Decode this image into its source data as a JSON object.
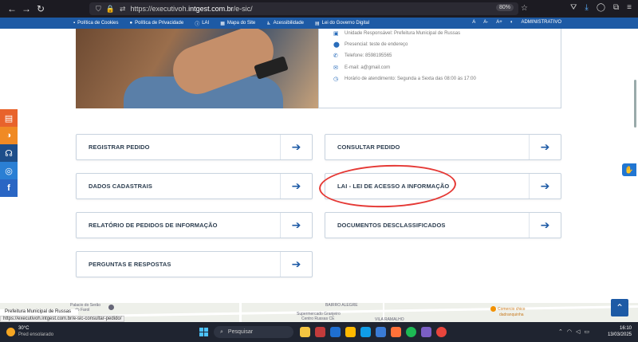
{
  "browser": {
    "url_prefix": "https://executivoh.",
    "url_domain": "intgest.com.br",
    "url_path": "/e-sic/",
    "zoom": "80%"
  },
  "govbar": {
    "items": [
      "Política de Cookies",
      "Política de Privacidade",
      "LAI",
      "Mapa do Site",
      "Acessibilidade",
      "Lei do Governo Digital"
    ],
    "font_controls": [
      "A",
      "A-",
      "A+"
    ],
    "admin": "ADMINISTRATIVO"
  },
  "info": {
    "unidade": "Unidade Responsável: Prefeitura Municipal de Russas",
    "presencial": "Presencial: teste de endereço",
    "telefone": "Telefone: 8598195565",
    "email": "E-mail: a@gmail.com",
    "horario": "Horário de atendimento: Segunda a Sexta das 08:00 às 17:00"
  },
  "buttons": {
    "registrar": "REGISTRAR PEDIDO",
    "consultar": "CONSULTAR PEDIDO",
    "dados": "DADOS CADASTRAIS",
    "lai": "LAI - LEI DE ACESSO A INFORMAÇÃO",
    "relatorio": "RELATÓRIO DE PEDIDOS DE INFORMAÇÃO",
    "documentos": "DOCUMENTOS DESCLASSIFICADOS",
    "perguntas": "PERGUNTAS E RESPOSTAS"
  },
  "map": {
    "label1": "Palacio do Serão",
    "label2": "do Farol",
    "label3": "BAIRRO ALEGRE",
    "label4": "Supermercado Granjeiro",
    "label5": "Centro Russas CE",
    "label6": "VILA RAMALHO",
    "label7": "Comercio chico",
    "label8": "dadranquinha",
    "pref": "Prefeitura Municipal de Russas"
  },
  "status_url": "https://executivoh.intgest.com.br/e-sic-consultar-pedido/",
  "taskbar": {
    "temp": "30°C",
    "weather": "Pred ensolarado",
    "search": "Pesquisar",
    "time": "16:10",
    "date": "13/03/2025"
  },
  "colors": {
    "primary": "#1d5aa5",
    "annotation": "#e53935"
  }
}
